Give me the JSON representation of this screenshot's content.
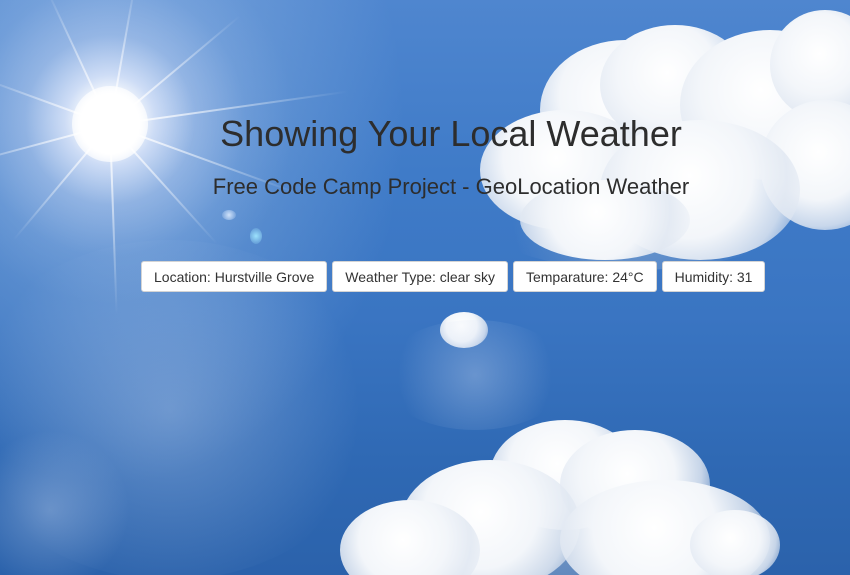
{
  "header": {
    "title": "Showing Your Local Weather",
    "subtitle": "Free Code Camp Project - GeoLocation Weather"
  },
  "weather": {
    "location": "Location: Hurstville Grove",
    "type": "Weather Type: clear sky",
    "temperature": "Temparature: 24°C",
    "humidity": "Humidity: 31"
  },
  "colors": {
    "sky": "#3a75c2",
    "chip_bg": "#ffffff",
    "chip_border": "#d4d4d4",
    "text": "#2d2d2d"
  }
}
